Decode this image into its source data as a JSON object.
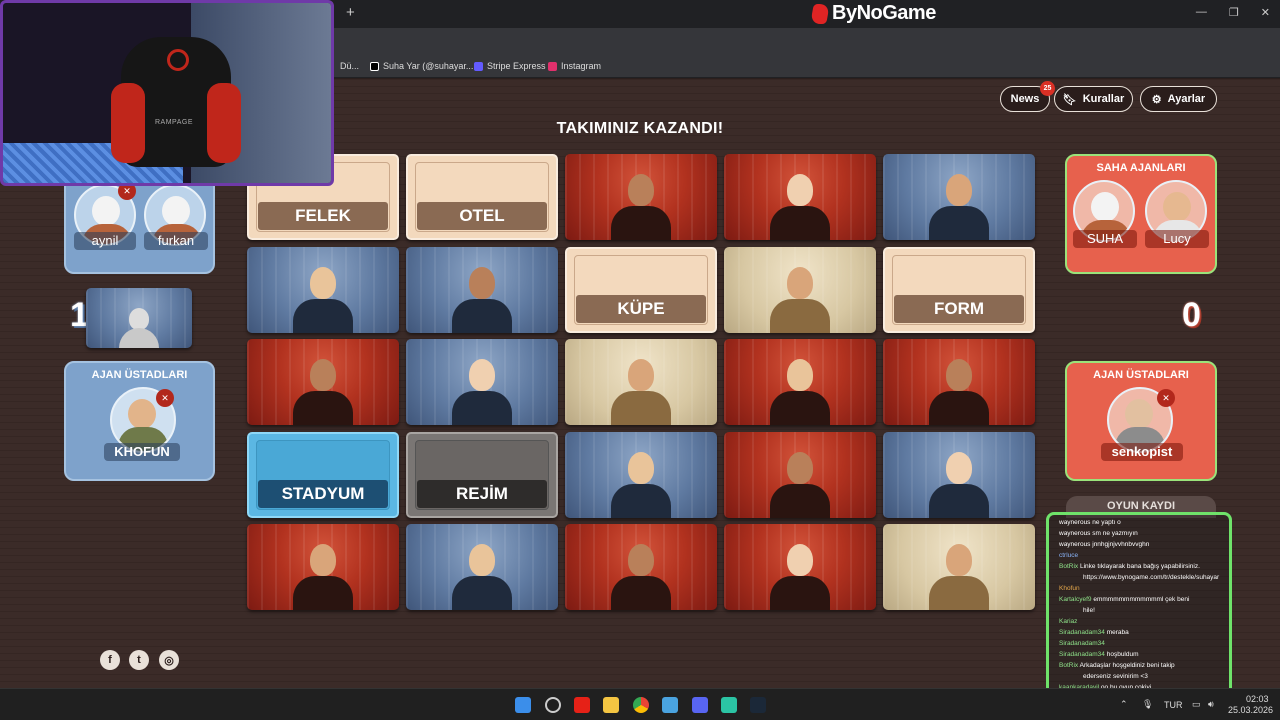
{
  "browser": {
    "brand": "ByNoGame",
    "new_tab": "+",
    "bookmarks": [
      "Dü...",
      "Suha Yar (@suhayar....",
      "Stripe Express",
      "Instagram"
    ]
  },
  "header": {
    "news_label": "News",
    "news_badge": "25",
    "rules_label": "Kurallar",
    "settings_label": "Ayarlar",
    "banner": "TAKIMINIZ KAZANDI!"
  },
  "board": {
    "cards": [
      {
        "type": "word",
        "label": "FELEK"
      },
      {
        "type": "word",
        "label": "OTEL"
      },
      {
        "type": "red",
        "label": ""
      },
      {
        "type": "red",
        "label": ""
      },
      {
        "type": "blue",
        "label": ""
      },
      {
        "type": "blue",
        "label": ""
      },
      {
        "type": "blue",
        "label": ""
      },
      {
        "type": "word",
        "label": "KÜPE"
      },
      {
        "type": "neutral",
        "label": ""
      },
      {
        "type": "word",
        "label": "FORM"
      },
      {
        "type": "red",
        "label": ""
      },
      {
        "type": "blue",
        "label": ""
      },
      {
        "type": "neutral",
        "label": ""
      },
      {
        "type": "red",
        "label": ""
      },
      {
        "type": "red",
        "label": ""
      },
      {
        "type": "bluecover",
        "label": "STADYUM"
      },
      {
        "type": "greycover",
        "label": "REJİM"
      },
      {
        "type": "blue",
        "label": ""
      },
      {
        "type": "red",
        "label": ""
      },
      {
        "type": "blue",
        "label": ""
      },
      {
        "type": "red",
        "label": ""
      },
      {
        "type": "blue",
        "label": ""
      },
      {
        "type": "red",
        "label": ""
      },
      {
        "type": "red",
        "label": ""
      },
      {
        "type": "neutral",
        "label": ""
      }
    ]
  },
  "blue_team": {
    "score": "1",
    "players": [
      "aynil",
      "furkan"
    ],
    "masters_title": "AJAN ÜSTADLARI",
    "master": "KHOFUN"
  },
  "red_team": {
    "score": "0",
    "agents_title": "SAHA AJANLARI",
    "players": [
      "SUHA",
      "Lucy"
    ],
    "masters_title": "AJAN ÜSTADLARI",
    "master": "senkopist"
  },
  "game_log": {
    "title": "OYUN KAYDI"
  },
  "chat": [
    {
      "user": "waynerous",
      "text": "ne yaptı o",
      "color": "#ffffff"
    },
    {
      "user": "waynerous",
      "text": "sm ne yazmıyın",
      "color": "#ffffff"
    },
    {
      "user": "waynerous",
      "text": "jnnhgjnjvvhnbvvghn",
      "color": "#ffffff"
    },
    {
      "user": "ctrluce",
      "text": "",
      "color": "#8ab4f8"
    },
    {
      "user": "BotRix",
      "text": "Linke tıklayarak bana bağış yapabilirsiniz.",
      "color": "#8fe38a"
    },
    {
      "user": "",
      "text": "https://www.bynogame.com/tr/destekle/suhayar",
      "color": "#ffffff"
    },
    {
      "user": "Khofun",
      "text": "",
      "color": "#e3a64a"
    },
    {
      "user": "Kartalcyef9",
      "text": "emmmmmmmmmmmml çek beni",
      "color": "#8fe38a"
    },
    {
      "user": "",
      "text": "hile!",
      "color": "#ffffff"
    },
    {
      "user": "Kariaz",
      "text": "",
      "color": "#8fe38a"
    },
    {
      "user": "Siradanadam34",
      "text": "meraba",
      "color": "#8fe38a"
    },
    {
      "user": "Siradanadam34",
      "text": "",
      "color": "#8fe38a"
    },
    {
      "user": "Siradanadam34",
      "text": "hoşbuldum",
      "color": "#8fe38a"
    },
    {
      "user": "BotRix",
      "text": "Arkadaşlar hoşgeldiniz beni takip",
      "color": "#8fe38a"
    },
    {
      "user": "",
      "text": "ederseniz sevinirim <3",
      "color": "#ffffff"
    },
    {
      "user": "kaankaradayil",
      "text": "oo bu oyun cokiyi",
      "color": "#8fe38a"
    }
  ],
  "taskbar": {
    "lang": "TUR",
    "time": "02:03",
    "date": "25.03.2026"
  },
  "webcam": {
    "chair_text": "RAMPAGE"
  },
  "colors": {
    "red_team": "#e7614d",
    "blue_team": "#7ea2cb",
    "accent_green": "#6fe36a"
  }
}
